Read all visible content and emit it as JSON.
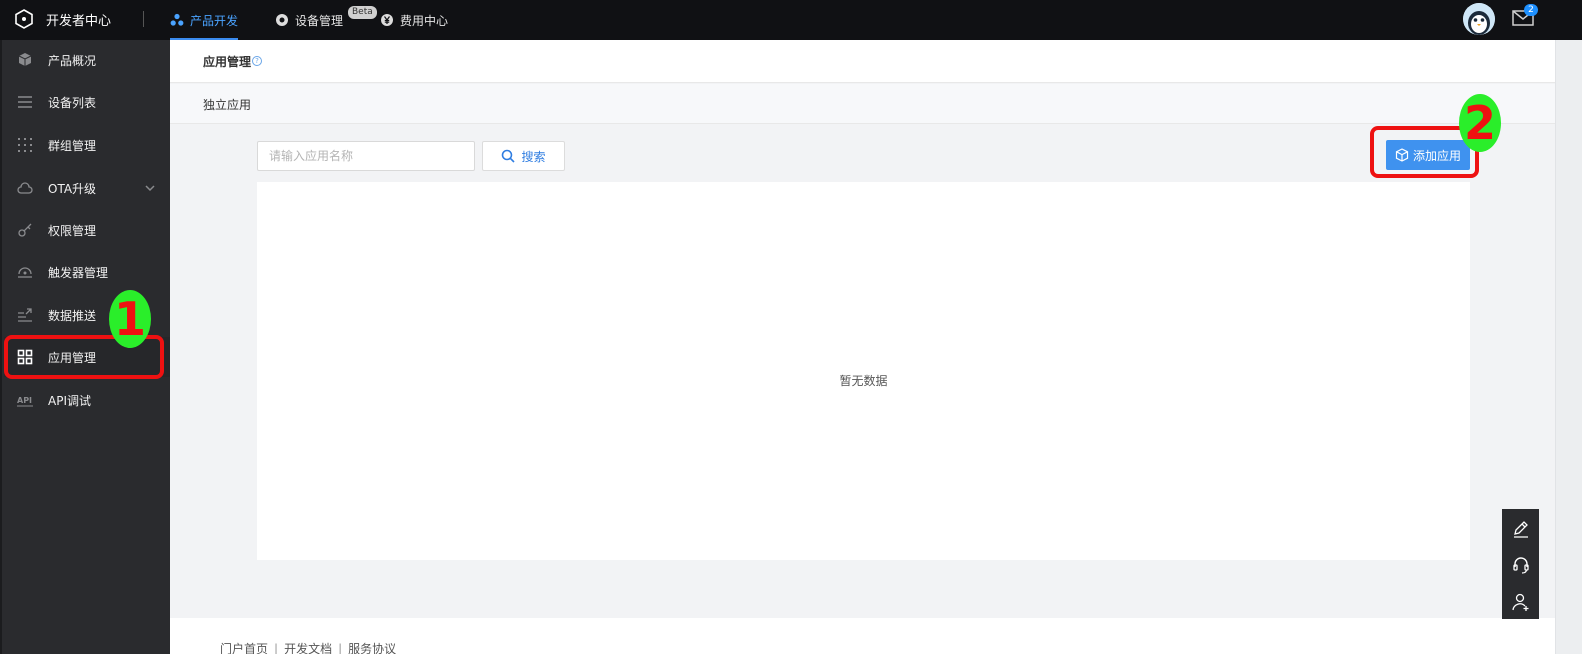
{
  "topbar": {
    "brand": "开发者中心",
    "nav": [
      {
        "label": "产品开发",
        "icon": "product-icon",
        "active": true
      },
      {
        "label": "设备管理",
        "icon": "device-icon",
        "badge": "Beta"
      },
      {
        "label": "费用中心",
        "icon": "yen-icon"
      }
    ],
    "mail_count": "2"
  },
  "sidebar": {
    "items": [
      {
        "label": "产品概况",
        "icon": "cube-icon"
      },
      {
        "label": "设备列表",
        "icon": "list-icon"
      },
      {
        "label": "群组管理",
        "icon": "grid-dots-icon"
      },
      {
        "label": "OTA升级",
        "icon": "cloud-icon",
        "expandable": true
      },
      {
        "label": "权限管理",
        "icon": "key-icon"
      },
      {
        "label": "触发器管理",
        "icon": "trigger-icon"
      },
      {
        "label": "数据推送",
        "icon": "push-icon"
      },
      {
        "label": "应用管理",
        "icon": "apps-icon",
        "active": true
      },
      {
        "label": "API调试",
        "icon": "api-icon"
      }
    ]
  },
  "main": {
    "title": "应用管理",
    "help": "?",
    "tab": "独立应用",
    "search": {
      "placeholder": "请输入应用名称",
      "button": "搜索"
    },
    "add_button": "添加应用",
    "empty_text": "暂无数据"
  },
  "footer": {
    "links": [
      "门户首页",
      "开发文档",
      "服务协议"
    ]
  },
  "annotations": {
    "step1": "1",
    "step2": "2",
    "color": "#ee1111"
  }
}
